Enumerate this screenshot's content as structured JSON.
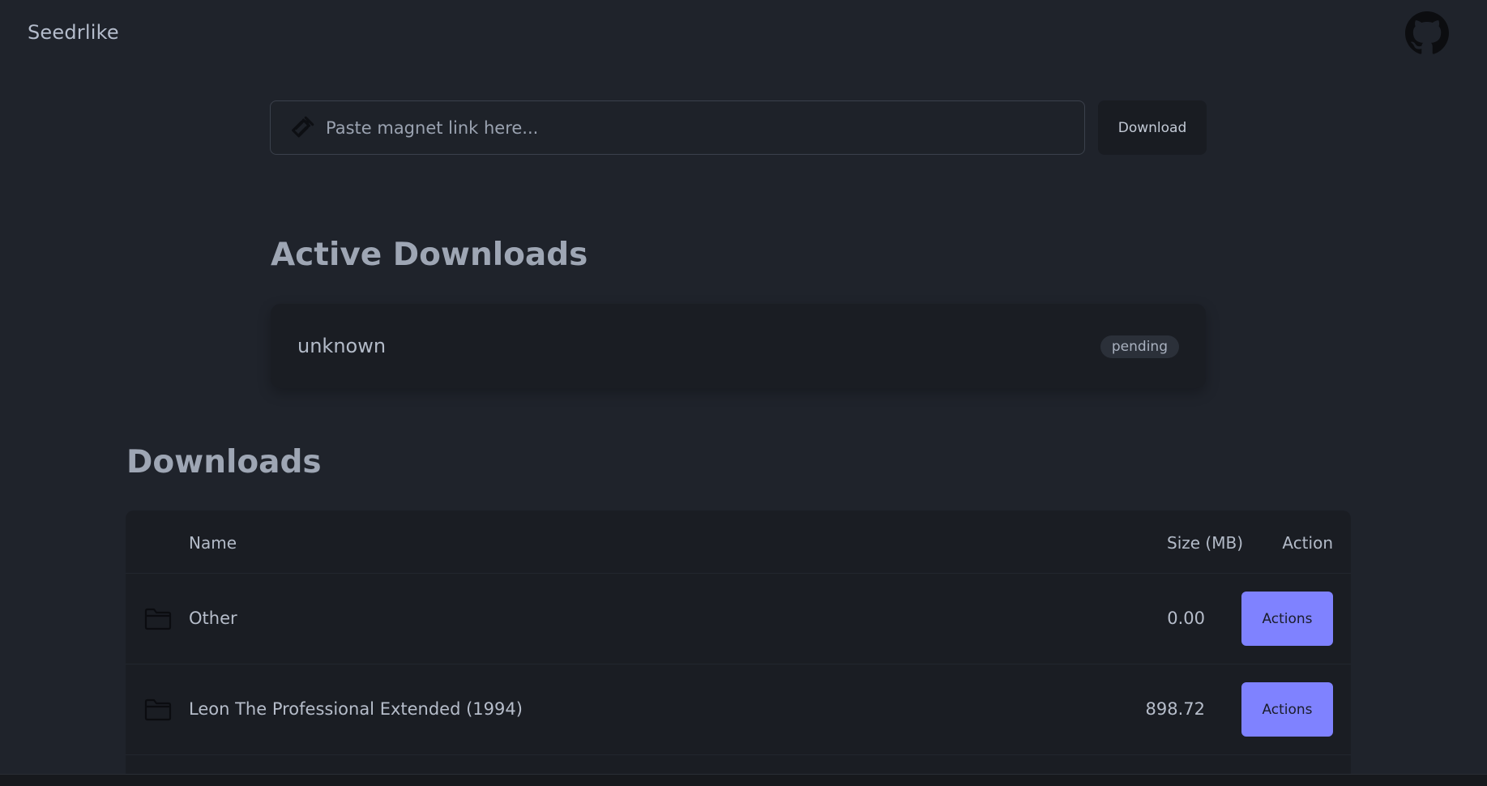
{
  "header": {
    "brand": "Seedrlike",
    "github_icon": "github-icon"
  },
  "magnet": {
    "placeholder": "Paste magnet link here...",
    "value": "",
    "icon": "magnet-icon",
    "download_label": "Download"
  },
  "active": {
    "title": "Active Downloads",
    "items": [
      {
        "name": "unknown",
        "status": "pending"
      }
    ]
  },
  "downloads": {
    "title": "Downloads",
    "columns": {
      "name": "Name",
      "size": "Size (MB)",
      "action": "Action"
    },
    "rows": [
      {
        "name": "Other",
        "size": "0.00",
        "action_label": "Actions",
        "icon": "folder-icon"
      },
      {
        "name": "Leon The Professional Extended (1994)",
        "size": "898.72",
        "action_label": "Actions",
        "icon": "folder-icon"
      }
    ]
  },
  "colors": {
    "background": "#1f232b",
    "card": "#1a1d23",
    "accent": "#7f82ff"
  }
}
